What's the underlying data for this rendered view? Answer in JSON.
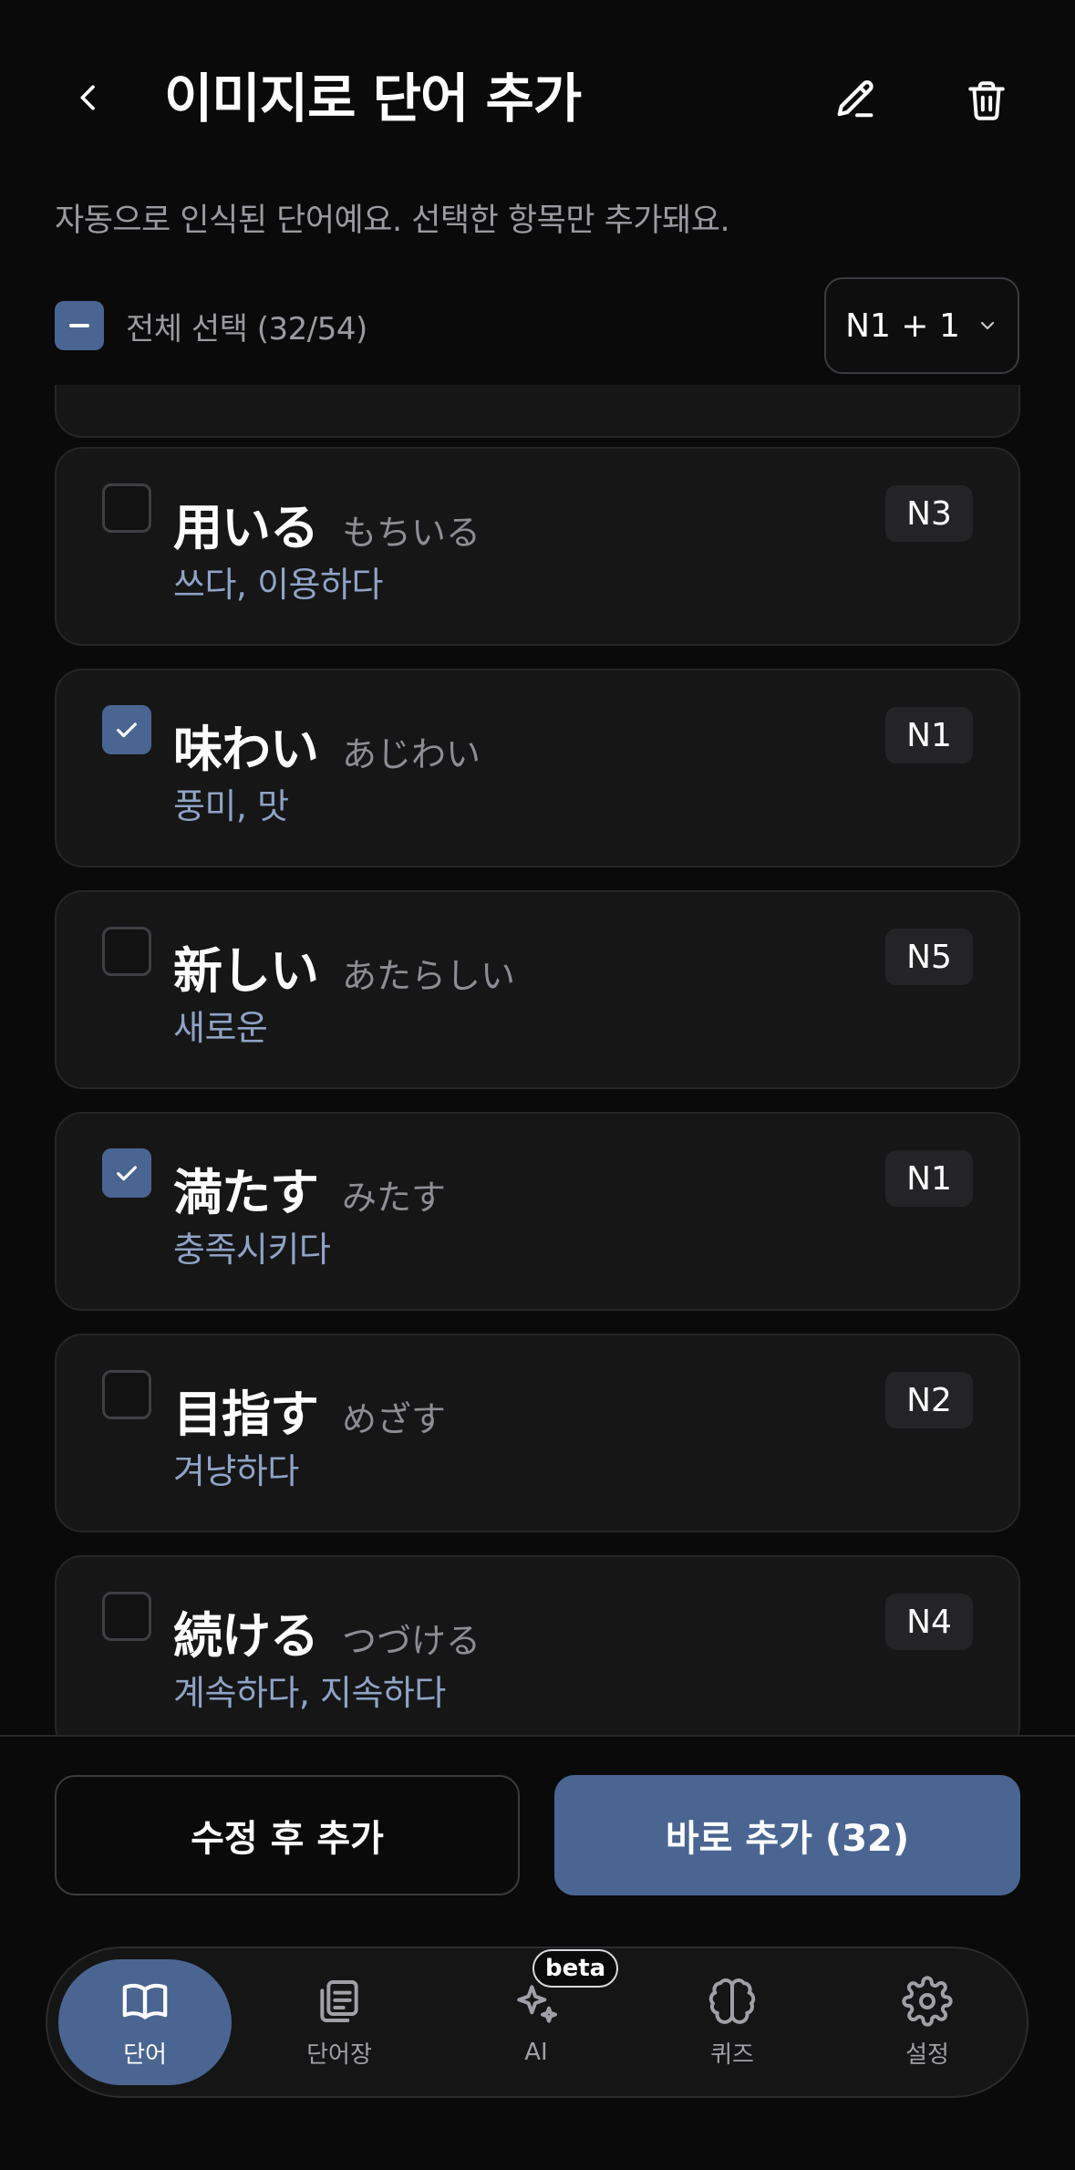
{
  "header": {
    "title": "이미지로 단어 추가",
    "back_icon": "chevron-left-icon",
    "edit_icon": "pencil-icon",
    "delete_icon": "trash-icon"
  },
  "subtitle": "자동으로 인식된 단어예요. 선택한 항목만 추가돼요.",
  "select_all": {
    "label": "전체 선택 (32/54)",
    "state": "indeterminate"
  },
  "filter": {
    "label": "N1 + 1"
  },
  "words": [
    {
      "word": "用いる",
      "reading": "もちいる",
      "meaning": "쓰다, 이용하다",
      "level": "N3",
      "checked": false
    },
    {
      "word": "味わい",
      "reading": "あじわい",
      "meaning": "풍미, 맛",
      "level": "N1",
      "checked": true
    },
    {
      "word": "新しい",
      "reading": "あたらしい",
      "meaning": "새로운",
      "level": "N5",
      "checked": false
    },
    {
      "word": "満たす",
      "reading": "みたす",
      "meaning": "충족시키다",
      "level": "N1",
      "checked": true
    },
    {
      "word": "目指す",
      "reading": "めざす",
      "meaning": "겨냥하다",
      "level": "N2",
      "checked": false
    },
    {
      "word": "続ける",
      "reading": "つづける",
      "meaning": "계속하다, 지속하다",
      "level": "N4",
      "checked": false
    }
  ],
  "actions": {
    "edit_then_add": "수정 후 추가",
    "add_now": "바로 추가 (32)"
  },
  "tabs": [
    {
      "label": "단어",
      "icon": "book-open-icon",
      "active": true
    },
    {
      "label": "단어장",
      "icon": "notebook-stack-icon",
      "active": false
    },
    {
      "label": "AI",
      "icon": "sparkles-icon",
      "active": false,
      "badge": "beta"
    },
    {
      "label": "퀴즈",
      "icon": "brain-icon",
      "active": false
    },
    {
      "label": "설정",
      "icon": "gear-icon",
      "active": false
    }
  ],
  "colors": {
    "background": "#0a0a0a",
    "accent": "#4a6591",
    "card": "#161617",
    "meaning_text": "#8fa3c6"
  }
}
